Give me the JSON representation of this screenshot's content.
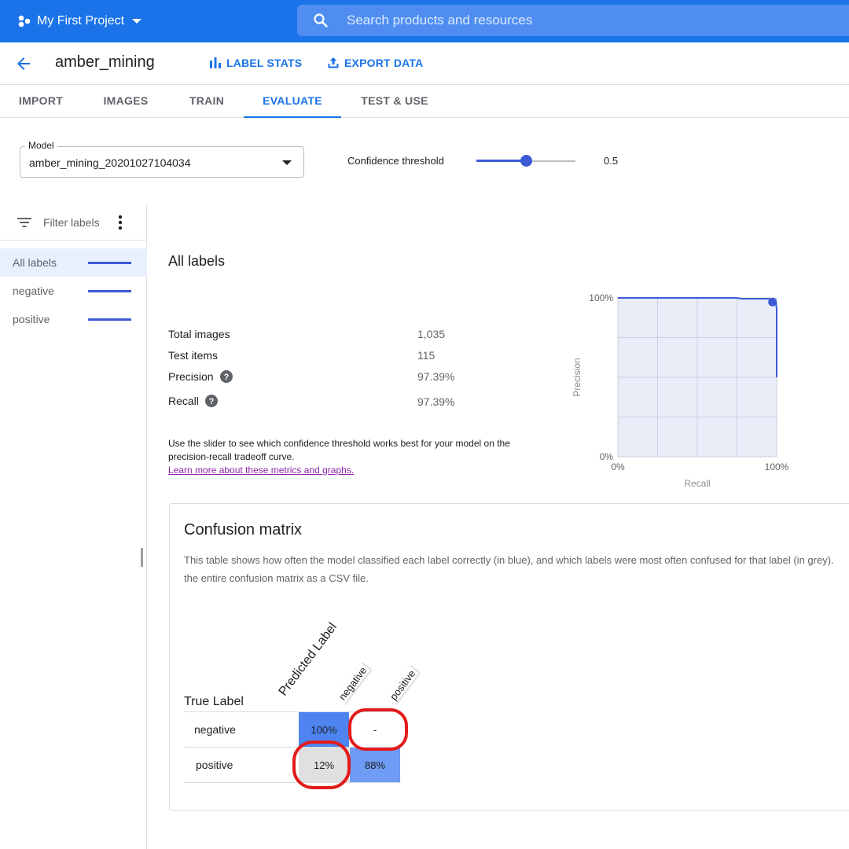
{
  "topbar": {
    "project_name": "My First Project",
    "search_placeholder": "Search products and resources",
    "color": "#1a73e8"
  },
  "header": {
    "dataset_name": "amber_mining",
    "label_stats": "LABEL STATS",
    "export_data": "EXPORT DATA"
  },
  "tabs": [
    {
      "label": "IMPORT",
      "active": false
    },
    {
      "label": "IMAGES",
      "active": false
    },
    {
      "label": "TRAIN",
      "active": false
    },
    {
      "label": "EVALUATE",
      "active": true
    },
    {
      "label": "TEST & USE",
      "active": false
    }
  ],
  "model": {
    "label": "Model",
    "value": "amber_mining_20201027104034"
  },
  "confidence": {
    "label": "Confidence threshold",
    "value": "0.5",
    "fraction": 0.5
  },
  "sidebar": {
    "filter_placeholder": "Filter labels",
    "labels": [
      {
        "label": "All labels",
        "selected": true
      },
      {
        "label": "negative",
        "selected": false
      },
      {
        "label": "positive",
        "selected": false
      }
    ]
  },
  "summary": {
    "title": "All labels",
    "total_images_label": "Total images",
    "total_images": "1,035",
    "test_items_label": "Test items",
    "test_items": "115",
    "precision_label": "Precision",
    "precision": "97.39%",
    "recall_label": "Recall",
    "recall": "97.39%",
    "help_text": "Use the slider to see which confidence threshold works best for your model on the precision-recall tradeoff curve.",
    "help_link": "Learn more about these metrics and graphs."
  },
  "chart_data": {
    "type": "line",
    "title": "",
    "xlabel": "Recall",
    "ylabel": "Precision",
    "xlim": [
      0,
      100
    ],
    "ylim": [
      0,
      100
    ],
    "x_tick_labels": [
      "0%",
      "100%"
    ],
    "y_tick_labels": [
      "0%",
      "100%"
    ],
    "grid": true,
    "series": [
      {
        "x": [
          0,
          25,
          50,
          75,
          78,
          95,
          98.5,
          99.5,
          100,
          100
        ],
        "y": [
          100,
          100,
          100,
          100,
          99.5,
          99.5,
          98.5,
          97.5,
          93,
          50
        ]
      }
    ],
    "threshold_point": {
      "x": 97.39,
      "y": 97.39
    },
    "line_color": "#3c5ad6",
    "fill_color": "#e8edf8"
  },
  "confusion": {
    "title": "Confusion matrix",
    "desc_line1": "This table shows how often the model classified each label correctly (in blue), and which labels were most often confused for that label (in grey).",
    "desc_line2": "the entire confusion matrix as a CSV file.",
    "true_label": "True Label",
    "predicted_label": "Predicted Label",
    "columns": [
      "negative",
      "positive"
    ],
    "rows": [
      {
        "label": "negative",
        "cells": [
          "100%",
          "-"
        ]
      },
      {
        "label": "positive",
        "cells": [
          "12%",
          "88%"
        ]
      }
    ],
    "highlight_color": "#e31b1b"
  }
}
